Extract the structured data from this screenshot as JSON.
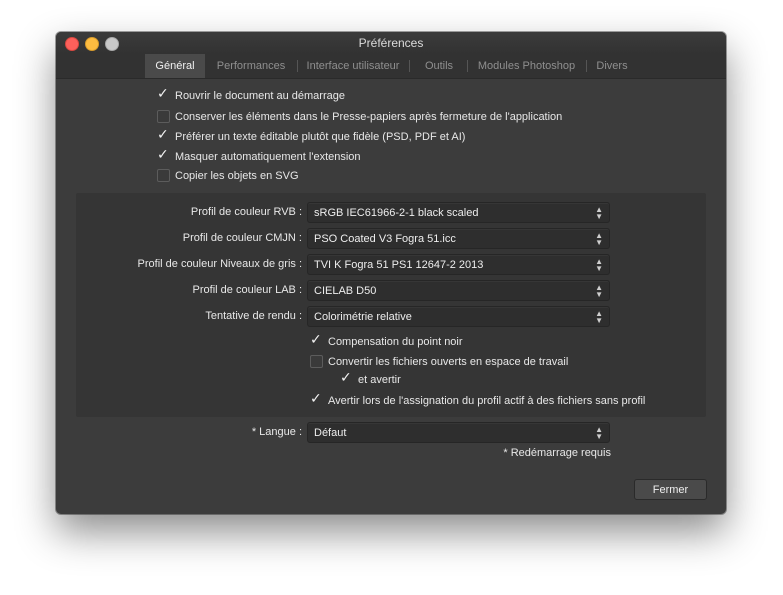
{
  "window": {
    "title": "Préférences",
    "controls": [
      "close",
      "minimize",
      "zoom"
    ]
  },
  "tabs": [
    {
      "label": "Général",
      "active": true
    },
    {
      "label": "Performances",
      "active": false
    },
    {
      "label": "Interface utilisateur",
      "active": false
    },
    {
      "label": "Outils",
      "active": false
    },
    {
      "label": "Modules Photoshop",
      "active": false
    },
    {
      "label": "Divers",
      "active": false
    }
  ],
  "general": {
    "options": [
      {
        "label": "Rouvrir le document au démarrage",
        "checked": true
      },
      {
        "label": "Conserver les éléments dans le Presse-papiers après fermeture de l'application",
        "checked": false
      },
      {
        "label": "Préférer un texte éditable plutôt que fidèle (PSD, PDF et AI)",
        "checked": true
      },
      {
        "label": "Masquer automatiquement l'extension",
        "checked": true
      },
      {
        "label": "Copier les objets en SVG",
        "checked": false
      }
    ]
  },
  "color": {
    "profiles": [
      {
        "label": "Profil de couleur RVB :",
        "value": "sRGB IEC61966-2-1 black scaled"
      },
      {
        "label": "Profil de couleur CMJN :",
        "value": "PSO Coated V3 Fogra 51.icc"
      },
      {
        "label": "Profil de couleur Niveaux de gris :",
        "value": "TVI K Fogra 51 PS1 12647-2 2013"
      },
      {
        "label": "Profil de couleur LAB :",
        "value": "CIELAB D50"
      },
      {
        "label": "Tentative de rendu :",
        "value": "Colorimétrie relative"
      }
    ],
    "options": [
      {
        "label": "Compensation du point noir",
        "checked": true
      },
      {
        "label": "Convertir les fichiers ouverts en espace de travail",
        "checked": false
      },
      {
        "label": "et avertir",
        "checked": true
      },
      {
        "label": "Avertir lors de l'assignation du profil actif à des fichiers sans profil",
        "checked": true
      }
    ]
  },
  "language": {
    "label": "* Langue :",
    "value": "Défaut",
    "note": "* Redémarrage requis"
  },
  "footer": {
    "close_label": "Fermer"
  },
  "colors": {
    "window_bg": "#3c3c3c",
    "titlebar_bg": "#323232",
    "panel_bg": "#353535",
    "text": "#e8e8e8",
    "tab_inactive_text": "#8f8f8f",
    "close_dot": "#fc605b",
    "minimize_dot": "#fdbc40",
    "zoom_dot": "#c8c8c8"
  }
}
